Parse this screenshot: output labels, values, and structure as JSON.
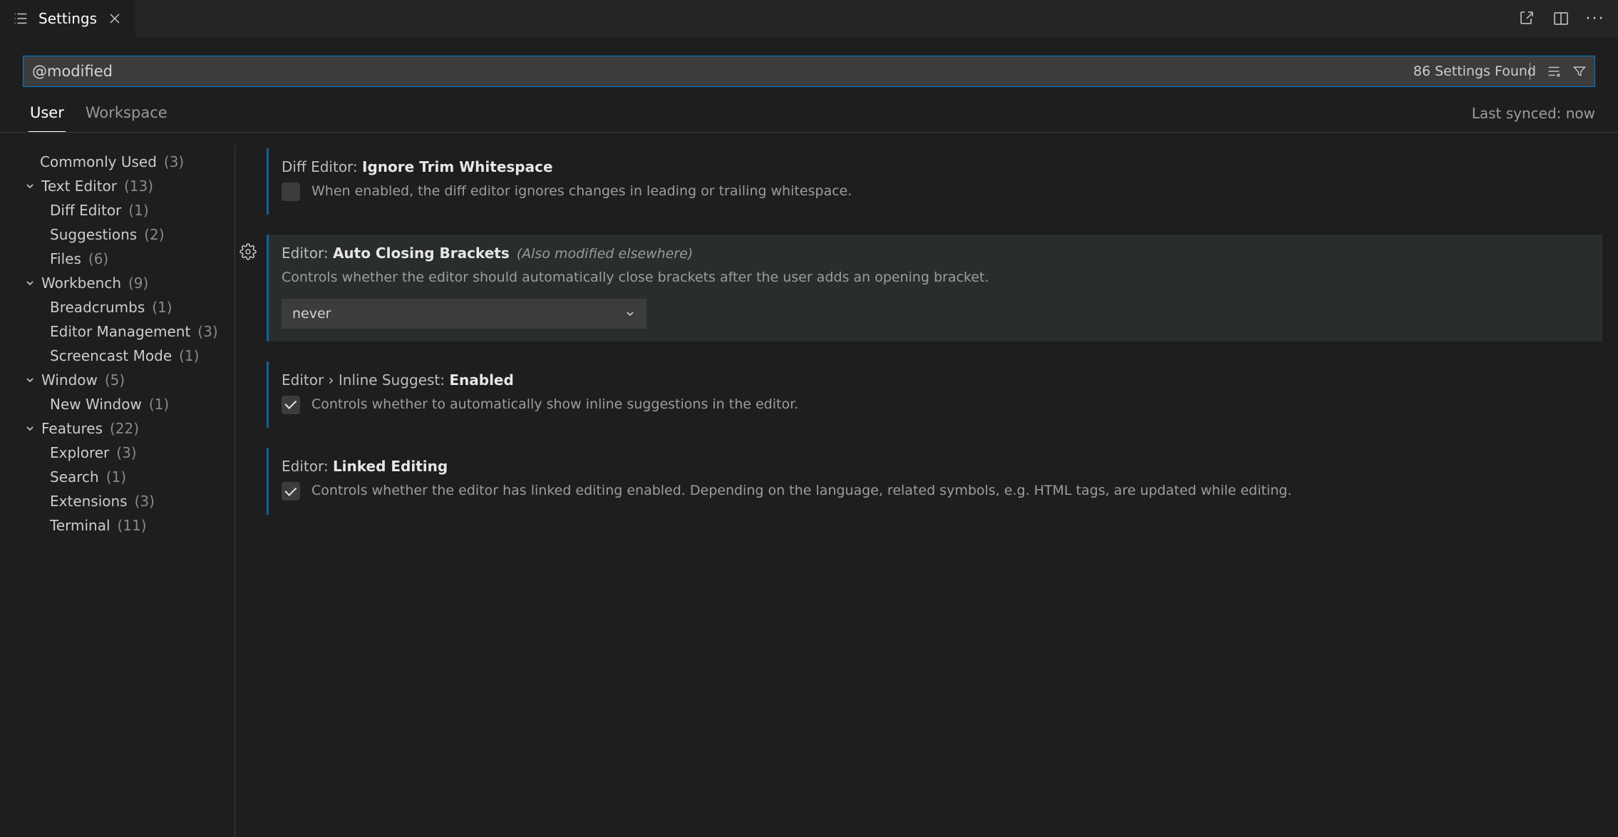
{
  "tab": {
    "title": "Settings"
  },
  "search": {
    "value": "@modified",
    "results_label": "86 Settings Found"
  },
  "scope": {
    "tabs": [
      "User",
      "Workspace"
    ],
    "active": "User",
    "sync_label": "Last synced: now"
  },
  "toc": [
    {
      "kind": "leaf0",
      "label": "Commonly Used",
      "count": "(3)"
    },
    {
      "kind": "group",
      "label": "Text Editor",
      "count": "(13)"
    },
    {
      "kind": "child",
      "label": "Diff Editor",
      "count": "(1)"
    },
    {
      "kind": "child",
      "label": "Suggestions",
      "count": "(2)"
    },
    {
      "kind": "child",
      "label": "Files",
      "count": "(6)"
    },
    {
      "kind": "group",
      "label": "Workbench",
      "count": "(9)"
    },
    {
      "kind": "child",
      "label": "Breadcrumbs",
      "count": "(1)"
    },
    {
      "kind": "child",
      "label": "Editor Management",
      "count": "(3)"
    },
    {
      "kind": "child",
      "label": "Screencast Mode",
      "count": "(1)"
    },
    {
      "kind": "group",
      "label": "Window",
      "count": "(5)"
    },
    {
      "kind": "child",
      "label": "New Window",
      "count": "(1)"
    },
    {
      "kind": "group",
      "label": "Features",
      "count": "(22)"
    },
    {
      "kind": "child",
      "label": "Explorer",
      "count": "(3)"
    },
    {
      "kind": "child",
      "label": "Search",
      "count": "(1)"
    },
    {
      "kind": "child",
      "label": "Extensions",
      "count": "(3)"
    },
    {
      "kind": "child",
      "label": "Terminal",
      "count": "(11)"
    }
  ],
  "settings": [
    {
      "prefix": "Diff Editor: ",
      "name": "Ignore Trim Whitespace",
      "note": "",
      "control": "checkbox",
      "checked": false,
      "desc": "When enabled, the diff editor ignores changes in leading or trailing whitespace.",
      "highlight": false,
      "gear": false
    },
    {
      "prefix": "Editor: ",
      "name": "Auto Closing Brackets",
      "note": "(Also modified elsewhere)",
      "control": "select",
      "value": "never",
      "desc": "Controls whether the editor should automatically close brackets after the user adds an opening bracket.",
      "highlight": true,
      "gear": true
    },
    {
      "prefix": "Editor › Inline Suggest: ",
      "name": "Enabled",
      "note": "",
      "control": "checkbox",
      "checked": true,
      "desc": "Controls whether to automatically show inline suggestions in the editor.",
      "highlight": false,
      "gear": false
    },
    {
      "prefix": "Editor: ",
      "name": "Linked Editing",
      "note": "",
      "control": "checkbox",
      "checked": true,
      "desc": "Controls whether the editor has linked editing enabled. Depending on the language, related symbols, e.g. HTML tags, are updated while editing.",
      "highlight": false,
      "gear": false
    }
  ]
}
